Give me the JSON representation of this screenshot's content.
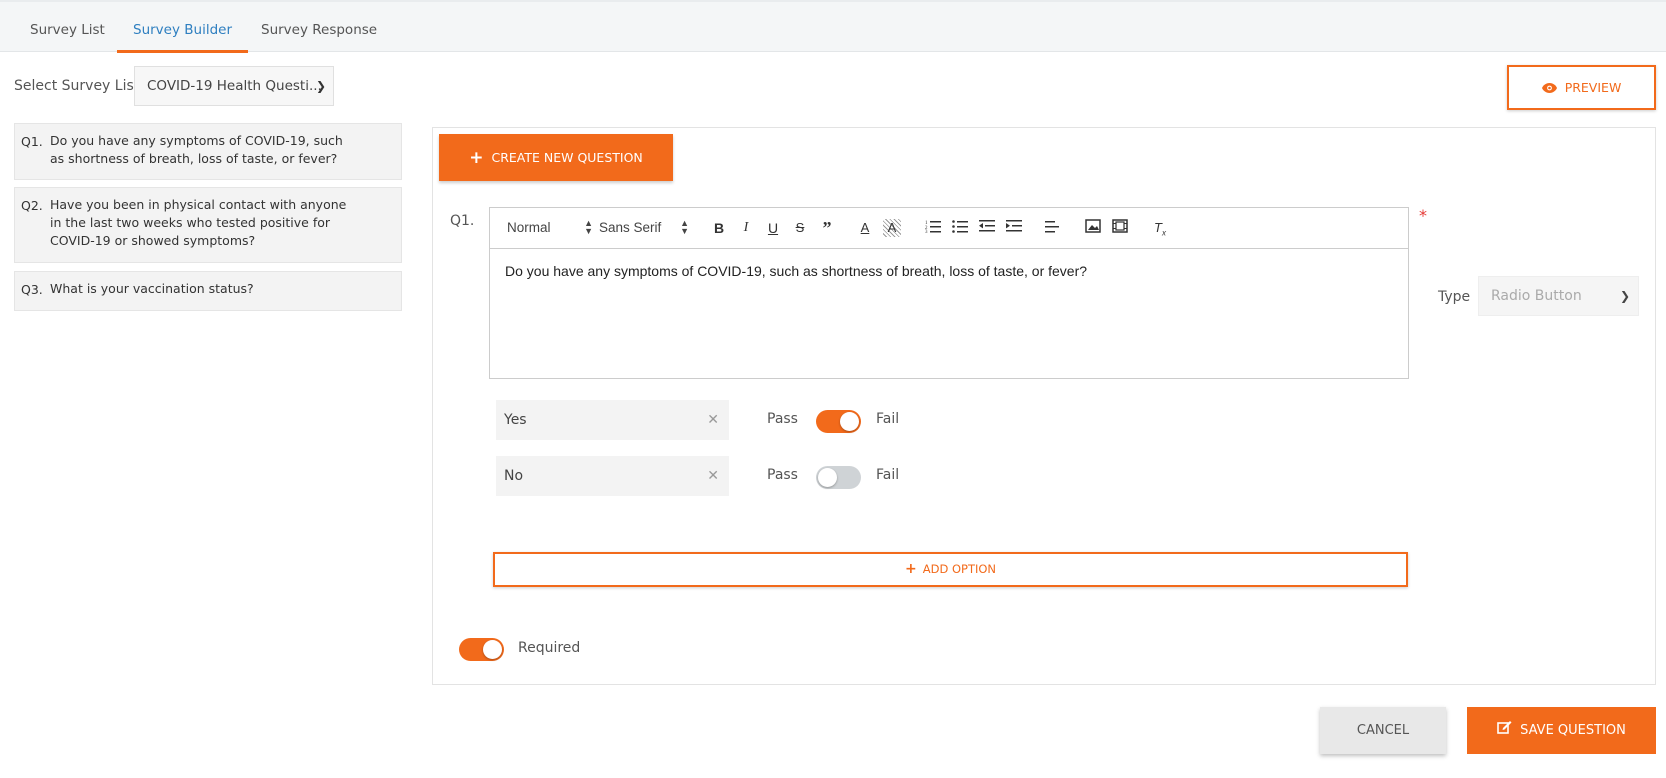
{
  "tabs": [
    {
      "label": "Survey List",
      "active": false
    },
    {
      "label": "Survey Builder",
      "active": true
    },
    {
      "label": "Survey Response",
      "active": false
    }
  ],
  "survey_select": {
    "label": "Select Survey List",
    "value": "COVID-19 Health Questi..."
  },
  "preview_label": "PREVIEW",
  "questions": [
    {
      "num": "Q1.",
      "text": "Do you have any symptoms of COVID-19, such as shortness of breath, loss of taste, or fever?"
    },
    {
      "num": "Q2.",
      "text": "Have you been in physical contact with anyone in the last two weeks who tested positive for COVID-19 or showed symptoms?"
    },
    {
      "num": "Q3.",
      "text": "What is your vaccination status?"
    }
  ],
  "create_label": "CREATE NEW QUESTION",
  "editor": {
    "question_num": "Q1.",
    "required_star": "*",
    "format": "Normal",
    "font": "Sans Serif",
    "content": "Do you have any symptoms of COVID-19, such as shortness of breath, loss of taste, or fever?"
  },
  "type": {
    "label": "Type",
    "value": "Radio Button"
  },
  "options": [
    {
      "value": "Yes",
      "pass": "Pass",
      "fail": "Fail",
      "toggle_on": true
    },
    {
      "value": "No",
      "pass": "Pass",
      "fail": "Fail",
      "toggle_on": false
    }
  ],
  "add_option_label": "ADD OPTION",
  "required": {
    "label": "Required",
    "on": true
  },
  "cancel_label": "CANCEL",
  "save_label": "SAVE QUESTION",
  "colors": {
    "accent": "#f26a1b",
    "link": "#2e7fc0"
  }
}
